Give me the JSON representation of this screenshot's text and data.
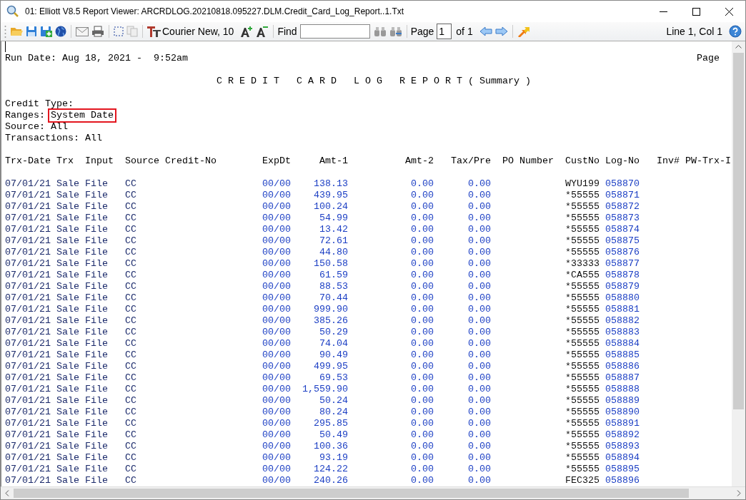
{
  "window": {
    "title": "01: Elliott V8.5 Report Viewer: ARCRDLOG.20210818.095227.DLM.Credit_Card_Log_Report..1.Txt"
  },
  "toolbar": {
    "font": "Courier New, 10",
    "find_label": "Find",
    "page_label": "Page",
    "page_value": "1",
    "page_total": "of 1",
    "position": "Line 1, Col 1"
  },
  "report": {
    "run_date": "Run Date: Aug 18, 2021 -  9:52am",
    "page_label": "Page",
    "title": "C R E D I T   C A R D   L O G   R E P O R T ( Summary )",
    "filters": [
      {
        "label": "Credit Type:"
      },
      {
        "label": "Ranges:",
        "value": "System Date",
        "highlighted": true
      },
      {
        "label": "Source:",
        "value": "All",
        "highlighted": false
      },
      {
        "label": "Transactions:",
        "value": "All",
        "highlighted": false
      }
    ],
    "columns": [
      "Trx-Date",
      "Trx",
      "Input",
      "Source",
      "Credit-No",
      "ExpDt",
      "Amt-1",
      "Amt-2",
      "Tax/Pre",
      "PO Number",
      "CustNo",
      "Log-No",
      "Inv#",
      "PW-Trx-I"
    ],
    "rows": [
      {
        "trx_date": "07/01/21",
        "trx": "Sale",
        "input": "File",
        "source": "CC",
        "exp_dt": "00/00",
        "amt_1": "138.13",
        "amt_2": "0.00",
        "tax_pre": "0.00",
        "cust_no": "WYU199",
        "log_no": "058870"
      },
      {
        "trx_date": "07/01/21",
        "trx": "Sale",
        "input": "File",
        "source": "CC",
        "exp_dt": "00/00",
        "amt_1": "439.95",
        "amt_2": "0.00",
        "tax_pre": "0.00",
        "cust_no": "*55555",
        "log_no": "058871"
      },
      {
        "trx_date": "07/01/21",
        "trx": "Sale",
        "input": "File",
        "source": "CC",
        "exp_dt": "00/00",
        "amt_1": "100.24",
        "amt_2": "0.00",
        "tax_pre": "0.00",
        "cust_no": "*55555",
        "log_no": "058872"
      },
      {
        "trx_date": "07/01/21",
        "trx": "Sale",
        "input": "File",
        "source": "CC",
        "exp_dt": "00/00",
        "amt_1": "54.99",
        "amt_2": "0.00",
        "tax_pre": "0.00",
        "cust_no": "*55555",
        "log_no": "058873"
      },
      {
        "trx_date": "07/01/21",
        "trx": "Sale",
        "input": "File",
        "source": "CC",
        "exp_dt": "00/00",
        "amt_1": "13.42",
        "amt_2": "0.00",
        "tax_pre": "0.00",
        "cust_no": "*55555",
        "log_no": "058874"
      },
      {
        "trx_date": "07/01/21",
        "trx": "Sale",
        "input": "File",
        "source": "CC",
        "exp_dt": "00/00",
        "amt_1": "72.61",
        "amt_2": "0.00",
        "tax_pre": "0.00",
        "cust_no": "*55555",
        "log_no": "058875"
      },
      {
        "trx_date": "07/01/21",
        "trx": "Sale",
        "input": "File",
        "source": "CC",
        "exp_dt": "00/00",
        "amt_1": "44.80",
        "amt_2": "0.00",
        "tax_pre": "0.00",
        "cust_no": "*55555",
        "log_no": "058876"
      },
      {
        "trx_date": "07/01/21",
        "trx": "Sale",
        "input": "File",
        "source": "CC",
        "exp_dt": "00/00",
        "amt_1": "150.58",
        "amt_2": "0.00",
        "tax_pre": "0.00",
        "cust_no": "*33333",
        "log_no": "058877"
      },
      {
        "trx_date": "07/01/21",
        "trx": "Sale",
        "input": "File",
        "source": "CC",
        "exp_dt": "00/00",
        "amt_1": "61.59",
        "amt_2": "0.00",
        "tax_pre": "0.00",
        "cust_no": "*CA555",
        "log_no": "058878"
      },
      {
        "trx_date": "07/01/21",
        "trx": "Sale",
        "input": "File",
        "source": "CC",
        "exp_dt": "00/00",
        "amt_1": "88.53",
        "amt_2": "0.00",
        "tax_pre": "0.00",
        "cust_no": "*55555",
        "log_no": "058879"
      },
      {
        "trx_date": "07/01/21",
        "trx": "Sale",
        "input": "File",
        "source": "CC",
        "exp_dt": "00/00",
        "amt_1": "70.44",
        "amt_2": "0.00",
        "tax_pre": "0.00",
        "cust_no": "*55555",
        "log_no": "058880"
      },
      {
        "trx_date": "07/01/21",
        "trx": "Sale",
        "input": "File",
        "source": "CC",
        "exp_dt": "00/00",
        "amt_1": "999.90",
        "amt_2": "0.00",
        "tax_pre": "0.00",
        "cust_no": "*55555",
        "log_no": "058881"
      },
      {
        "trx_date": "07/01/21",
        "trx": "Sale",
        "input": "File",
        "source": "CC",
        "exp_dt": "00/00",
        "amt_1": "385.26",
        "amt_2": "0.00",
        "tax_pre": "0.00",
        "cust_no": "*55555",
        "log_no": "058882"
      },
      {
        "trx_date": "07/01/21",
        "trx": "Sale",
        "input": "File",
        "source": "CC",
        "exp_dt": "00/00",
        "amt_1": "50.29",
        "amt_2": "0.00",
        "tax_pre": "0.00",
        "cust_no": "*55555",
        "log_no": "058883"
      },
      {
        "trx_date": "07/01/21",
        "trx": "Sale",
        "input": "File",
        "source": "CC",
        "exp_dt": "00/00",
        "amt_1": "74.04",
        "amt_2": "0.00",
        "tax_pre": "0.00",
        "cust_no": "*55555",
        "log_no": "058884"
      },
      {
        "trx_date": "07/01/21",
        "trx": "Sale",
        "input": "File",
        "source": "CC",
        "exp_dt": "00/00",
        "amt_1": "90.49",
        "amt_2": "0.00",
        "tax_pre": "0.00",
        "cust_no": "*55555",
        "log_no": "058885"
      },
      {
        "trx_date": "07/01/21",
        "trx": "Sale",
        "input": "File",
        "source": "CC",
        "exp_dt": "00/00",
        "amt_1": "499.95",
        "amt_2": "0.00",
        "tax_pre": "0.00",
        "cust_no": "*55555",
        "log_no": "058886"
      },
      {
        "trx_date": "07/01/21",
        "trx": "Sale",
        "input": "File",
        "source": "CC",
        "exp_dt": "00/00",
        "amt_1": "69.53",
        "amt_2": "0.00",
        "tax_pre": "0.00",
        "cust_no": "*55555",
        "log_no": "058887"
      },
      {
        "trx_date": "07/01/21",
        "trx": "Sale",
        "input": "File",
        "source": "CC",
        "exp_dt": "00/00",
        "amt_1": "1,559.90",
        "amt_2": "0.00",
        "tax_pre": "0.00",
        "cust_no": "*55555",
        "log_no": "058888"
      },
      {
        "trx_date": "07/01/21",
        "trx": "Sale",
        "input": "File",
        "source": "CC",
        "exp_dt": "00/00",
        "amt_1": "50.24",
        "amt_2": "0.00",
        "tax_pre": "0.00",
        "cust_no": "*55555",
        "log_no": "058889"
      },
      {
        "trx_date": "07/01/21",
        "trx": "Sale",
        "input": "File",
        "source": "CC",
        "exp_dt": "00/00",
        "amt_1": "80.24",
        "amt_2": "0.00",
        "tax_pre": "0.00",
        "cust_no": "*55555",
        "log_no": "058890"
      },
      {
        "trx_date": "07/01/21",
        "trx": "Sale",
        "input": "File",
        "source": "CC",
        "exp_dt": "00/00",
        "amt_1": "295.85",
        "amt_2": "0.00",
        "tax_pre": "0.00",
        "cust_no": "*55555",
        "log_no": "058891"
      },
      {
        "trx_date": "07/01/21",
        "trx": "Sale",
        "input": "File",
        "source": "CC",
        "exp_dt": "00/00",
        "amt_1": "50.49",
        "amt_2": "0.00",
        "tax_pre": "0.00",
        "cust_no": "*55555",
        "log_no": "058892"
      },
      {
        "trx_date": "07/01/21",
        "trx": "Sale",
        "input": "File",
        "source": "CC",
        "exp_dt": "00/00",
        "amt_1": "100.36",
        "amt_2": "0.00",
        "tax_pre": "0.00",
        "cust_no": "*55555",
        "log_no": "058893"
      },
      {
        "trx_date": "07/01/21",
        "trx": "Sale",
        "input": "File",
        "source": "CC",
        "exp_dt": "00/00",
        "amt_1": "93.19",
        "amt_2": "0.00",
        "tax_pre": "0.00",
        "cust_no": "*55555",
        "log_no": "058894"
      },
      {
        "trx_date": "07/01/21",
        "trx": "Sale",
        "input": "File",
        "source": "CC",
        "exp_dt": "00/00",
        "amt_1": "124.22",
        "amt_2": "0.00",
        "tax_pre": "0.00",
        "cust_no": "*55555",
        "log_no": "058895"
      },
      {
        "trx_date": "07/01/21",
        "trx": "Sale",
        "input": "File",
        "source": "CC",
        "exp_dt": "00/00",
        "amt_1": "240.26",
        "amt_2": "0.00",
        "tax_pre": "0.00",
        "cust_no": "FEC325",
        "log_no": "058896"
      }
    ]
  }
}
